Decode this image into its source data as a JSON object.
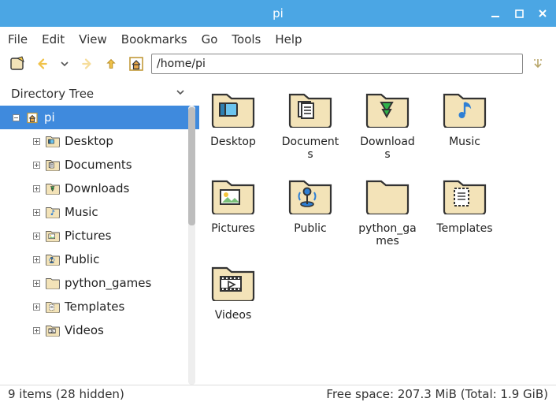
{
  "window": {
    "title": "pi"
  },
  "menu": {
    "file": "File",
    "edit": "Edit",
    "view": "View",
    "bookmarks": "Bookmarks",
    "go": "Go",
    "tools": "Tools",
    "help": "Help"
  },
  "toolbar": {
    "path": "/home/pi"
  },
  "sidebar": {
    "title": "Directory Tree",
    "root": "pi",
    "items": [
      {
        "label": "Desktop",
        "icon": "desktop"
      },
      {
        "label": "Documents",
        "icon": "documents"
      },
      {
        "label": "Downloads",
        "icon": "downloads"
      },
      {
        "label": "Music",
        "icon": "music"
      },
      {
        "label": "Pictures",
        "icon": "pictures"
      },
      {
        "label": "Public",
        "icon": "public"
      },
      {
        "label": "python_games",
        "icon": "folder"
      },
      {
        "label": "Templates",
        "icon": "templates"
      },
      {
        "label": "Videos",
        "icon": "videos"
      }
    ]
  },
  "folders": [
    {
      "label": "Desktop",
      "icon": "desktop"
    },
    {
      "label": "Documents",
      "icon": "documents"
    },
    {
      "label": "Downloads",
      "icon": "downloads"
    },
    {
      "label": "Music",
      "icon": "music"
    },
    {
      "label": "Pictures",
      "icon": "pictures"
    },
    {
      "label": "Public",
      "icon": "public"
    },
    {
      "label": "python_games",
      "icon": "folder"
    },
    {
      "label": "Templates",
      "icon": "templates"
    },
    {
      "label": "Videos",
      "icon": "videos"
    }
  ],
  "status": {
    "left": "9 items (28 hidden)",
    "right": "Free space: 207.3 MiB (Total: 1.9 GiB)"
  }
}
